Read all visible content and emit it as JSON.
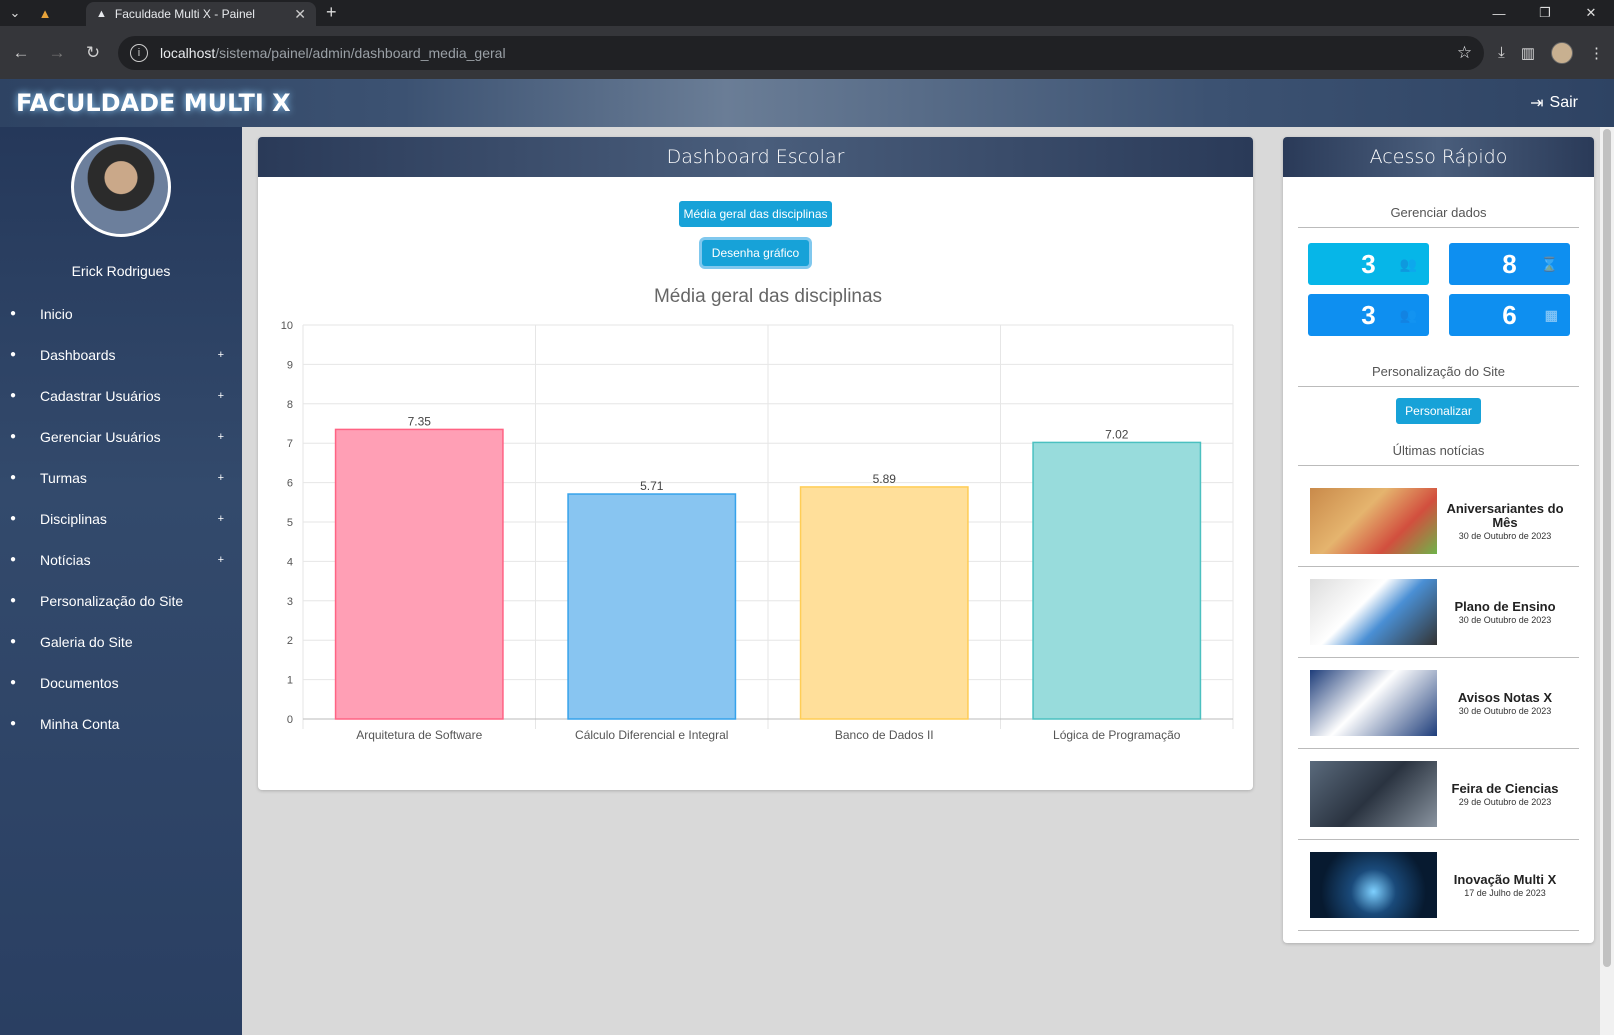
{
  "browser": {
    "tab_title": "Faculdade Multi X - Painel",
    "url_host": "localhost",
    "url_path": "/sistema/painel/admin/dashboard_media_geral"
  },
  "header": {
    "logo": "FACULDADE MULTI X",
    "logout": "Sair"
  },
  "sidebar": {
    "user_name": "Erick Rodrigues",
    "items": [
      {
        "label": "Inicio",
        "icon": "home-icon",
        "expandable": false
      },
      {
        "label": "Dashboards",
        "icon": "chart-line-icon",
        "expandable": true
      },
      {
        "label": "Cadastrar Usuários",
        "icon": "user-plus-icon",
        "expandable": true
      },
      {
        "label": "Gerenciar Usuários",
        "icon": "user-gear-icon",
        "expandable": true
      },
      {
        "label": "Turmas",
        "icon": "users-icon",
        "expandable": true
      },
      {
        "label": "Disciplinas",
        "icon": "book-icon",
        "expandable": true
      },
      {
        "label": "Notícias",
        "icon": "newspaper-icon",
        "expandable": true
      },
      {
        "label": "Personalização do Site",
        "icon": "laptop-icon",
        "expandable": false
      },
      {
        "label": "Galeria do Site",
        "icon": "image-icon",
        "expandable": false
      },
      {
        "label": "Documentos",
        "icon": "file-icon",
        "expandable": false
      },
      {
        "label": "Minha Conta",
        "icon": "id-card-icon",
        "expandable": false
      }
    ],
    "plus_symbol": "+"
  },
  "main": {
    "title": "Dashboard Escolar",
    "button_media": "Média geral das disciplinas",
    "button_draw": "Desenha gráfico"
  },
  "chart_data": {
    "type": "bar",
    "title": "Média geral das disciplinas",
    "categories": [
      "Arquitetura de Software",
      "Cálculo Diferencial e Integral",
      "Banco de Dados II",
      "Lógica de Programação"
    ],
    "values": [
      7.35,
      5.71,
      5.89,
      7.02
    ],
    "value_labels": [
      "7.35",
      "5.71",
      "5.89",
      "7.02"
    ],
    "ylim": [
      0,
      10
    ],
    "yticks": [
      "0",
      "1",
      "2",
      "3",
      "4",
      "5",
      "6",
      "7",
      "8",
      "9",
      "10"
    ],
    "colors": [
      "#ff9fb5",
      "#88c5f1",
      "#ffdf9a",
      "#98dcdc"
    ],
    "borders": [
      "#ff6384",
      "#36a2eb",
      "#ffcd56",
      "#4bc0c0"
    ],
    "grid": true
  },
  "quick": {
    "title": "Acesso Rápido",
    "manage_label": "Gerenciar dados",
    "stats": [
      {
        "value": "3",
        "icon": "users-icon"
      },
      {
        "value": "8",
        "icon": "hourglass-icon"
      },
      {
        "value": "3",
        "icon": "users-icon"
      },
      {
        "value": "6",
        "icon": "calendar-icon"
      }
    ],
    "customize_label": "Personalização do Site",
    "customize_button": "Personalizar",
    "news_label": "Últimas notícias",
    "news": [
      {
        "title": "Aniversariantes do Mês",
        "date": "30 de Outubro de 2023"
      },
      {
        "title": "Plano de Ensino",
        "date": "30 de Outubro de 2023"
      },
      {
        "title": "Avisos Notas X",
        "date": "30 de Outubro de 2023"
      },
      {
        "title": "Feira de Ciencias",
        "date": "29 de Outubro de 2023"
      },
      {
        "title": "Inovação Multi X",
        "date": "17 de Julho de 2023"
      }
    ]
  }
}
